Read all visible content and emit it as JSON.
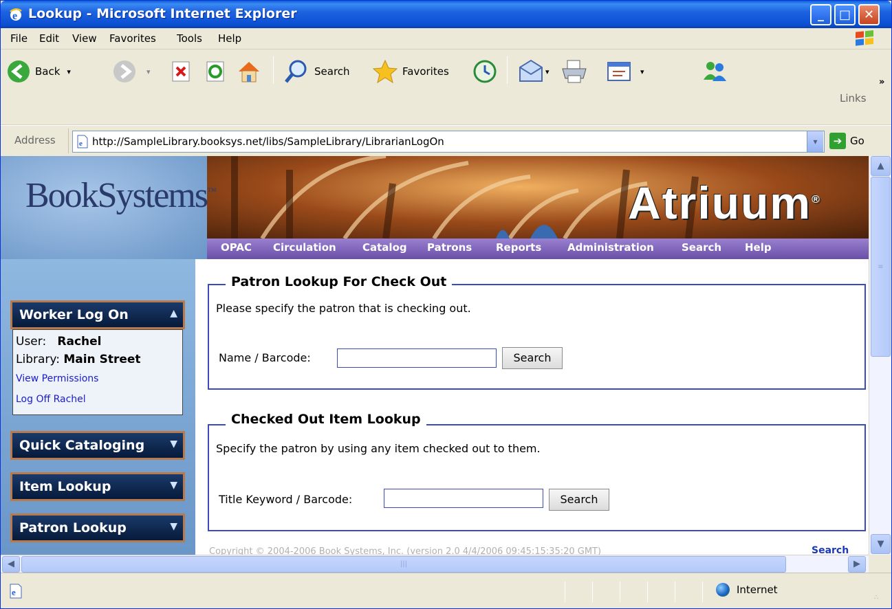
{
  "window": {
    "title": "Lookup - Microsoft Internet Explorer",
    "min": "_",
    "max": "□",
    "close": "✕"
  },
  "menu": [
    "File",
    "Edit",
    "View",
    "Favorites",
    "Tools",
    "Help"
  ],
  "toolbar": {
    "back": "Back",
    "search": "Search",
    "favorites": "Favorites",
    "links": "Links",
    "chevron": "»",
    "dropdown_arrow": "▾"
  },
  "address": {
    "label": "Address",
    "url": "http://SampleLibrary.booksys.net/libs/SampleLibrary/LibrarianLogOn",
    "go": "Go",
    "go_arrow": "➔",
    "dropdown": "▾"
  },
  "banner": {
    "logo": "BookSystems",
    "logo_tm": "™",
    "product": "Atriuum",
    "product_reg": "®"
  },
  "nav": [
    "OPAC",
    "Circulation",
    "Catalog",
    "Patrons",
    "Reports",
    "Administration",
    "Search",
    "Help"
  ],
  "sidebar": {
    "worker_log_on": "Worker Log On",
    "user_label": "User:",
    "user_value": "Rachel",
    "library_label": "Library:",
    "library_value": "Main Street",
    "view_permissions": "View Permissions",
    "log_off": "Log Off Rachel",
    "quick_cataloging": "Quick Cataloging",
    "item_lookup": "Item Lookup",
    "patron_lookup": "Patron Lookup",
    "caret_up": "▲",
    "caret_down": "▼"
  },
  "patron_lookup": {
    "legend": "Patron Lookup For Check Out",
    "instruction": "Please specify the patron that is checking out.",
    "field_label": "Name / Barcode:",
    "field_value": "",
    "button": "Search"
  },
  "item_lookup": {
    "legend": "Checked Out Item Lookup",
    "instruction": "Specify the patron by using any item checked out to them.",
    "field_label": "Title Keyword / Barcode:",
    "field_value": "",
    "button": "Search"
  },
  "footer": {
    "copyright": "Copyright © 2004-2006 Book Systems, Inc. (version 2.0 4/4/2006 09:45:15:35:20 GMT)",
    "search": "Search"
  },
  "scroll": {
    "up": "▲",
    "down": "▼",
    "left": "◀",
    "right": "▶",
    "grip": "≡",
    "hgrip": "|||"
  },
  "status": {
    "zone": "Internet",
    "grip": "∴"
  },
  "colors": {
    "titlebar": "#0a5fd8",
    "nav_strip": "#6a4fa8",
    "panel_head": "#071a3a",
    "panel_border": "#b87a4a",
    "fieldset_border": "#3a4ab8",
    "link": "#1a1ad0"
  }
}
